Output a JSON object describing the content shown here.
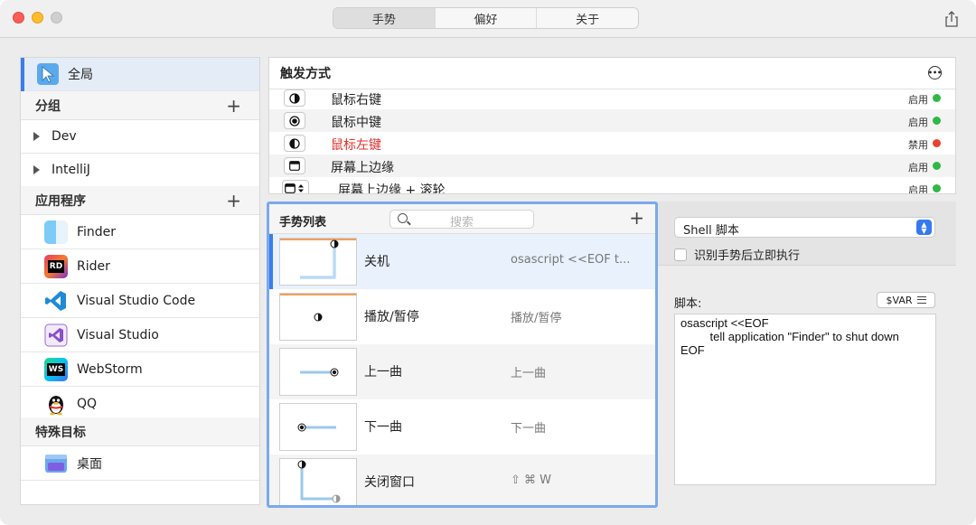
{
  "tabs": [
    {
      "label": "手势",
      "active": true
    },
    {
      "label": "偏好",
      "active": false
    },
    {
      "label": "关于",
      "active": false
    }
  ],
  "sidebar": {
    "global": {
      "label": "全局"
    },
    "groups_header": "分组",
    "groups": [
      "Dev",
      "IntelliJ"
    ],
    "apps_header": "应用程序",
    "apps": [
      {
        "label": "Finder",
        "icon": "finder-icon"
      },
      {
        "label": "Rider",
        "icon": "rider-icon"
      },
      {
        "label": "Visual Studio Code",
        "icon": "vscode-icon"
      },
      {
        "label": "Visual Studio",
        "icon": "visual-studio-icon"
      },
      {
        "label": "WebStorm",
        "icon": "webstorm-icon"
      },
      {
        "label": "QQ",
        "icon": "qq-icon"
      }
    ],
    "special_header": "特殊目标",
    "special": [
      {
        "label": "桌面",
        "icon": "desktop-icon"
      }
    ]
  },
  "trigger": {
    "title": "触发方式",
    "rows": [
      {
        "label": "鼠标右键",
        "status": "启用",
        "color": "#2fb846",
        "label_color": "#222222"
      },
      {
        "label": "鼠标中键",
        "status": "启用",
        "color": "#2fb846",
        "label_color": "#222222"
      },
      {
        "label": "鼠标左键",
        "status": "禁用",
        "color": "#e8432f",
        "label_color": "#e0302a"
      },
      {
        "label": "屏幕上边缘",
        "status": "启用",
        "color": "#2fb846",
        "label_color": "#222222"
      },
      {
        "label": "屏幕上边缘 + 滚轮",
        "status": "启用",
        "color": "#2fb846",
        "label_color": "#222222"
      }
    ]
  },
  "gesture_list": {
    "title": "手势列表",
    "search_placeholder": "搜索",
    "rows": [
      {
        "name": "关机",
        "command": "osascript <<EOF    t..."
      },
      {
        "name": "播放/暂停",
        "command": "播放/暂停"
      },
      {
        "name": "上一曲",
        "command": "上一曲"
      },
      {
        "name": "下一曲",
        "command": "下一曲"
      },
      {
        "name": "关闭窗口",
        "command": "⇧ ⌘ W"
      }
    ]
  },
  "detail": {
    "action_type": "Shell 脚本",
    "execute_immediately_label": "识别手势后立即执行",
    "execute_immediately": false,
    "script_label": "脚本:",
    "var_button": "$VAR",
    "script": "osascript <<EOF\n         tell application \"Finder\" to shut down\nEOF"
  },
  "colors": {
    "accent": "#3a7ee9",
    "selection": "#e9f1fd",
    "enabled": "#2fb846",
    "disabled": "#e8432f"
  }
}
